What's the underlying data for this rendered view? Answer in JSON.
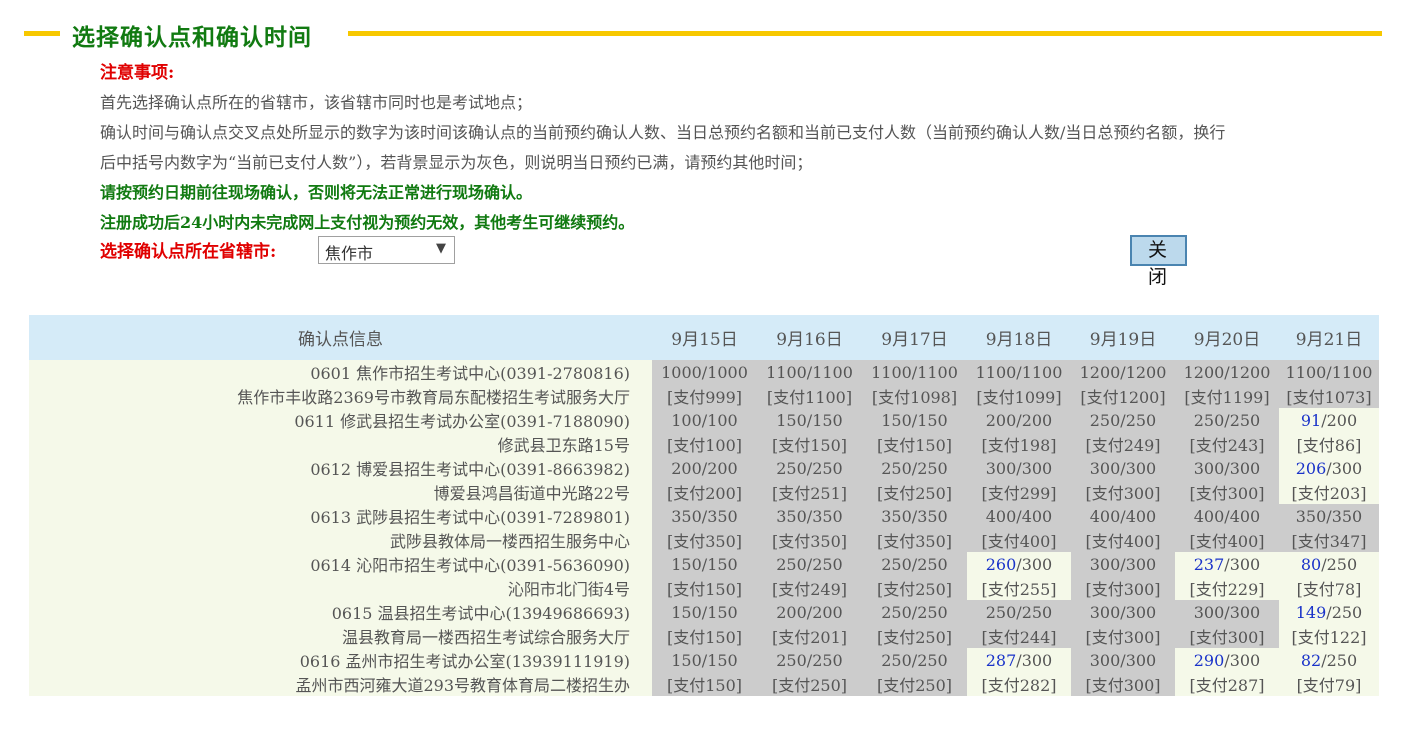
{
  "section": {
    "title": "选择确认点和确认时间"
  },
  "notes": {
    "title": "注意事项:",
    "line1": "首先选择确认点所在的省辖市，该省辖市同时也是考试地点；",
    "line2": "确认时间与确认点交叉点处所显示的数字为该时间该确认点的当前预约确认人数、当日总预约名额和当前已支付人数（当前预约确认人数/当日总预约名额，换行",
    "line3": "后中括号内数字为“当前已支付人数”），若背景显示为灰色，则说明当日预约已满，请预约其他时间；",
    "green1": "请按预约日期前往现场确认，否则将无法正常进行现场确认。",
    "green2": "注册成功后24小时内未完成网上支付视为预约无效，其他考生可继续预约。"
  },
  "city": {
    "label": "选择确认点所在省辖市:",
    "selected": "焦作市",
    "caret": "▼"
  },
  "close_button": {
    "label": "关闭"
  },
  "table": {
    "header_info": "确认点信息",
    "dates": [
      "9月15日",
      "9月16日",
      "9月17日",
      "9月18日",
      "9月19日",
      "9月20日",
      "9月21日"
    ],
    "colors": {
      "full": "#cccccc",
      "open": "#f5f9e9",
      "open_count": "#1a33c9"
    },
    "rows": [
      {
        "name": "0601 焦作市招生考试中心(0391-2780816)",
        "address": "焦作市丰收路2369号市教育局东配楼招生考试服务大厅",
        "slots": [
          {
            "count": "1000",
            "quota": "/1000",
            "paid": "[支付999]",
            "status": "full"
          },
          {
            "count": "1100",
            "quota": "/1100",
            "paid": "[支付1100]",
            "status": "full"
          },
          {
            "count": "1100",
            "quota": "/1100",
            "paid": "[支付1098]",
            "status": "full"
          },
          {
            "count": "1100",
            "quota": "/1100",
            "paid": "[支付1099]",
            "status": "full"
          },
          {
            "count": "1200",
            "quota": "/1200",
            "paid": "[支付1200]",
            "status": "full"
          },
          {
            "count": "1200",
            "quota": "/1200",
            "paid": "[支付1199]",
            "status": "full"
          },
          {
            "count": "1100",
            "quota": "/1100",
            "paid": "[支付1073]",
            "status": "full"
          }
        ]
      },
      {
        "name": "0611 修武县招生考试办公室(0391-7188090)",
        "address": "修武县卫东路15号",
        "slots": [
          {
            "count": "100",
            "quota": "/100",
            "paid": "[支付100]",
            "status": "full"
          },
          {
            "count": "150",
            "quota": "/150",
            "paid": "[支付150]",
            "status": "full"
          },
          {
            "count": "150",
            "quota": "/150",
            "paid": "[支付150]",
            "status": "full"
          },
          {
            "count": "200",
            "quota": "/200",
            "paid": "[支付198]",
            "status": "full"
          },
          {
            "count": "250",
            "quota": "/250",
            "paid": "[支付249]",
            "status": "full"
          },
          {
            "count": "250",
            "quota": "/250",
            "paid": "[支付243]",
            "status": "full"
          },
          {
            "count": "91",
            "quota": "/200",
            "paid": "[支付86]",
            "status": "open"
          }
        ]
      },
      {
        "name": "0612 博爱县招生考试中心(0391-8663982)",
        "address": "博爱县鸿昌街道中光路22号",
        "slots": [
          {
            "count": "200",
            "quota": "/200",
            "paid": "[支付200]",
            "status": "full"
          },
          {
            "count": "250",
            "quota": "/250",
            "paid": "[支付251]",
            "status": "full"
          },
          {
            "count": "250",
            "quota": "/250",
            "paid": "[支付250]",
            "status": "full"
          },
          {
            "count": "300",
            "quota": "/300",
            "paid": "[支付299]",
            "status": "full"
          },
          {
            "count": "300",
            "quota": "/300",
            "paid": "[支付300]",
            "status": "full"
          },
          {
            "count": "300",
            "quota": "/300",
            "paid": "[支付300]",
            "status": "full"
          },
          {
            "count": "206",
            "quota": "/300",
            "paid": "[支付203]",
            "status": "open"
          }
        ]
      },
      {
        "name": "0613 武陟县招生考试中心(0391-7289801)",
        "address": "武陟县教体局一楼西招生服务中心",
        "slots": [
          {
            "count": "350",
            "quota": "/350",
            "paid": "[支付350]",
            "status": "full"
          },
          {
            "count": "350",
            "quota": "/350",
            "paid": "[支付350]",
            "status": "full"
          },
          {
            "count": "350",
            "quota": "/350",
            "paid": "[支付350]",
            "status": "full"
          },
          {
            "count": "400",
            "quota": "/400",
            "paid": "[支付400]",
            "status": "full"
          },
          {
            "count": "400",
            "quota": "/400",
            "paid": "[支付400]",
            "status": "full"
          },
          {
            "count": "400",
            "quota": "/400",
            "paid": "[支付400]",
            "status": "full"
          },
          {
            "count": "350",
            "quota": "/350",
            "paid": "[支付347]",
            "status": "full"
          }
        ]
      },
      {
        "name": "0614 沁阳市招生考试中心(0391-5636090)",
        "address": "沁阳市北门街4号",
        "slots": [
          {
            "count": "150",
            "quota": "/150",
            "paid": "[支付150]",
            "status": "full"
          },
          {
            "count": "250",
            "quota": "/250",
            "paid": "[支付249]",
            "status": "full"
          },
          {
            "count": "250",
            "quota": "/250",
            "paid": "[支付250]",
            "status": "full"
          },
          {
            "count": "260",
            "quota": "/300",
            "paid": "[支付255]",
            "status": "open"
          },
          {
            "count": "300",
            "quota": "/300",
            "paid": "[支付300]",
            "status": "full"
          },
          {
            "count": "237",
            "quota": "/300",
            "paid": "[支付229]",
            "status": "open"
          },
          {
            "count": "80",
            "quota": "/250",
            "paid": "[支付78]",
            "status": "open"
          }
        ]
      },
      {
        "name": "0615 温县招生考试中心(13949686693)",
        "address": "温县教育局一楼西招生考试综合服务大厅",
        "slots": [
          {
            "count": "150",
            "quota": "/150",
            "paid": "[支付150]",
            "status": "full"
          },
          {
            "count": "200",
            "quota": "/200",
            "paid": "[支付201]",
            "status": "full"
          },
          {
            "count": "250",
            "quota": "/250",
            "paid": "[支付250]",
            "status": "full"
          },
          {
            "count": "250",
            "quota": "/250",
            "paid": "[支付244]",
            "status": "full"
          },
          {
            "count": "300",
            "quota": "/300",
            "paid": "[支付300]",
            "status": "full"
          },
          {
            "count": "300",
            "quota": "/300",
            "paid": "[支付300]",
            "status": "full"
          },
          {
            "count": "149",
            "quota": "/250",
            "paid": "[支付122]",
            "status": "open"
          }
        ]
      },
      {
        "name": "0616 孟州市招生考试办公室(13939111919)",
        "address": "孟州市西河雍大道293号教育体育局二楼招生办",
        "slots": [
          {
            "count": "150",
            "quota": "/150",
            "paid": "[支付150]",
            "status": "full"
          },
          {
            "count": "250",
            "quota": "/250",
            "paid": "[支付250]",
            "status": "full"
          },
          {
            "count": "250",
            "quota": "/250",
            "paid": "[支付250]",
            "status": "full"
          },
          {
            "count": "287",
            "quota": "/300",
            "paid": "[支付282]",
            "status": "open"
          },
          {
            "count": "300",
            "quota": "/300",
            "paid": "[支付300]",
            "status": "full"
          },
          {
            "count": "290",
            "quota": "/300",
            "paid": "[支付287]",
            "status": "open"
          },
          {
            "count": "82",
            "quota": "/250",
            "paid": "[支付79]",
            "status": "open"
          }
        ]
      }
    ]
  }
}
